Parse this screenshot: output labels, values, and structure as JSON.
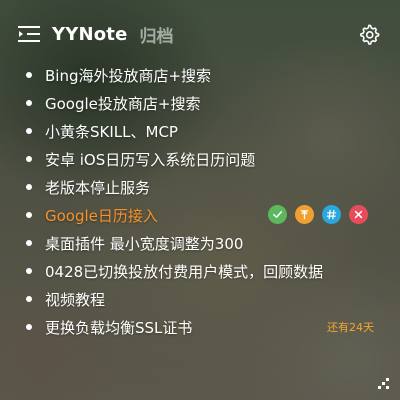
{
  "header": {
    "title": "YYNote",
    "archive_label": "归档",
    "menu_icon": "list-indent-icon",
    "settings_icon": "gear-icon"
  },
  "notes": [
    {
      "text": "Bing海外投放商店+搜索"
    },
    {
      "text": "Google投放商店+搜索"
    },
    {
      "text": "小黄条SKILL、MCP"
    },
    {
      "text": "安卓 iOS日历写入系统日历问题"
    },
    {
      "text": "老版本停止服务"
    },
    {
      "text": "Google日历接入",
      "active": true
    },
    {
      "text": "桌面插件 最小宽度调整为300"
    },
    {
      "text": "0428已切换投放付费用户模式，回顾数据"
    },
    {
      "text": "视频教程"
    },
    {
      "text": "更换负载均衡SSL证书",
      "badge": "还有24天"
    }
  ],
  "active_actions": [
    {
      "icon": "check-icon",
      "color": "#5cb85c",
      "glyph": "✓"
    },
    {
      "icon": "pin-icon",
      "color": "#f0a030",
      "glyph": "T"
    },
    {
      "icon": "hashtag-icon",
      "color": "#2aa7e0",
      "glyph": "#"
    },
    {
      "icon": "close-icon",
      "color": "#e84c5b",
      "glyph": "×"
    }
  ],
  "colors": {
    "accent": "#f6922a",
    "badge": "#f6a531",
    "text": "#ffffff",
    "archive": "rgba(255,255,255,0.55)"
  }
}
